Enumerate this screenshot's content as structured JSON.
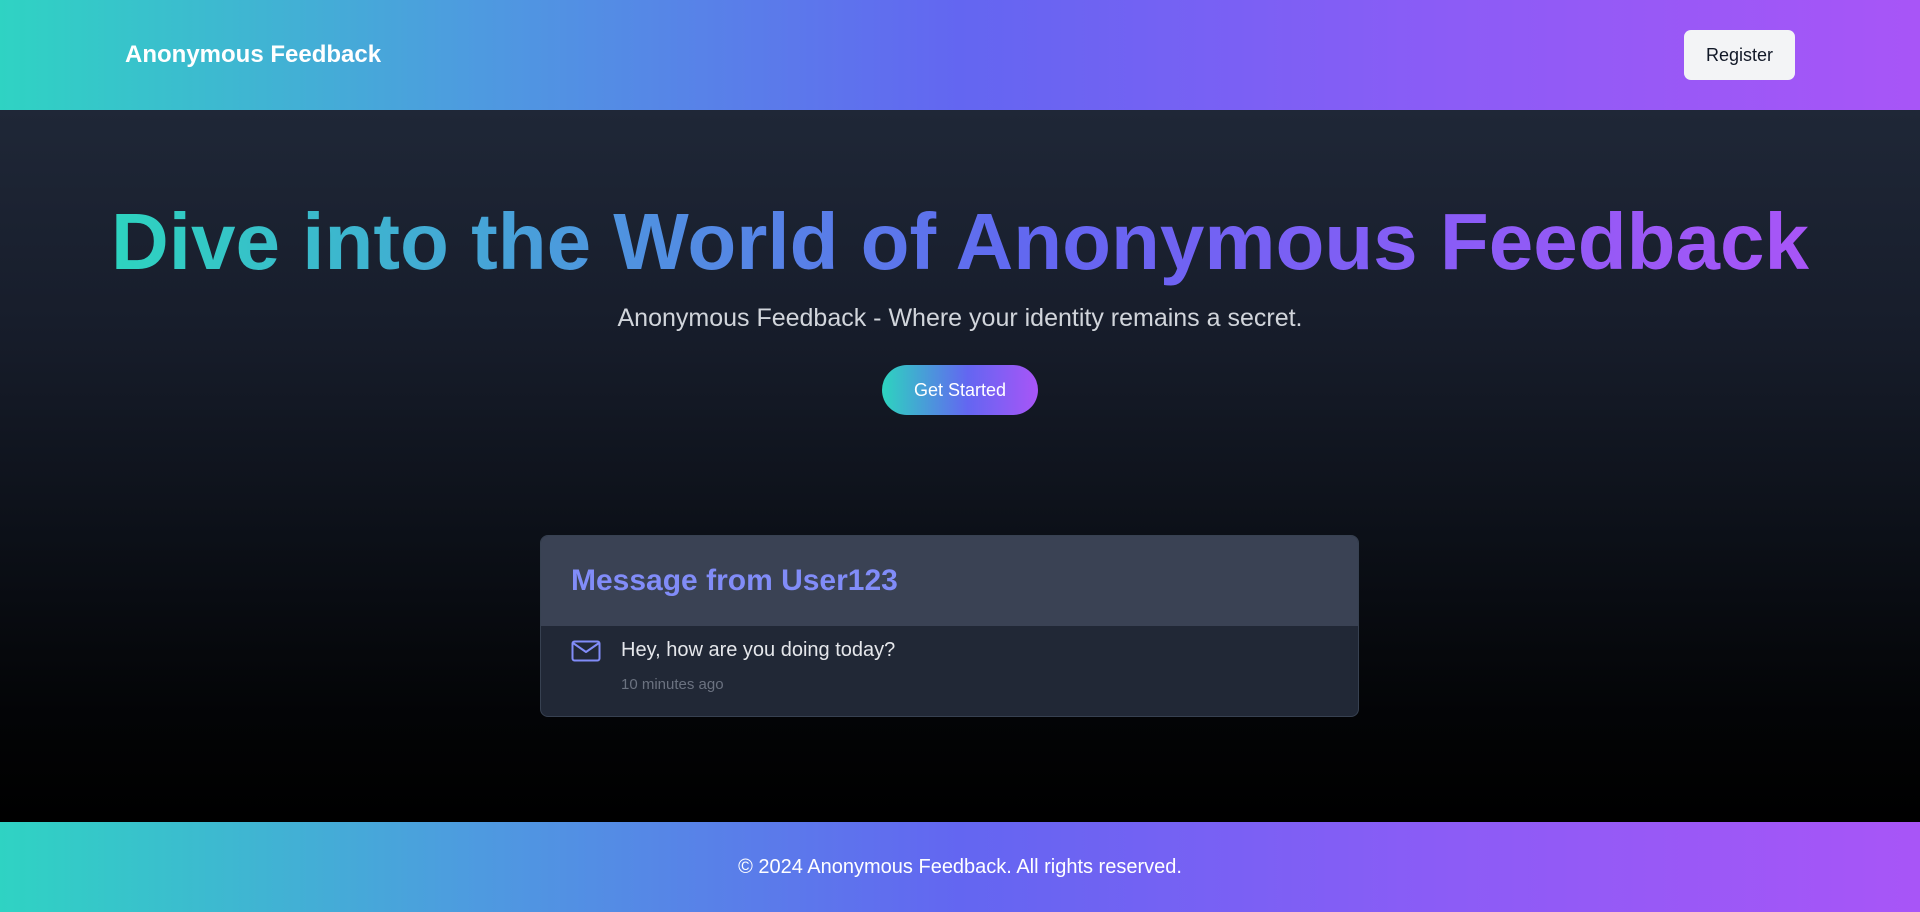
{
  "header": {
    "brand": "Anonymous Feedback",
    "register_label": "Register"
  },
  "hero": {
    "title": "Dive into the World of Anonymous Feedback",
    "subtitle": "Anonymous Feedback - Where your identity remains a secret.",
    "cta_label": "Get Started"
  },
  "message_card": {
    "title": "Message from User123",
    "icon": "mail-icon",
    "text": "Hey, how are you doing today?",
    "time": "10 minutes ago"
  },
  "footer": {
    "text": "© 2024 Anonymous Feedback. All rights reserved."
  },
  "colors": {
    "gradient_start": "#2dd4bf",
    "gradient_mid": "#6366f1",
    "gradient_end": "#a855f7",
    "card_title": "#818cf8"
  }
}
